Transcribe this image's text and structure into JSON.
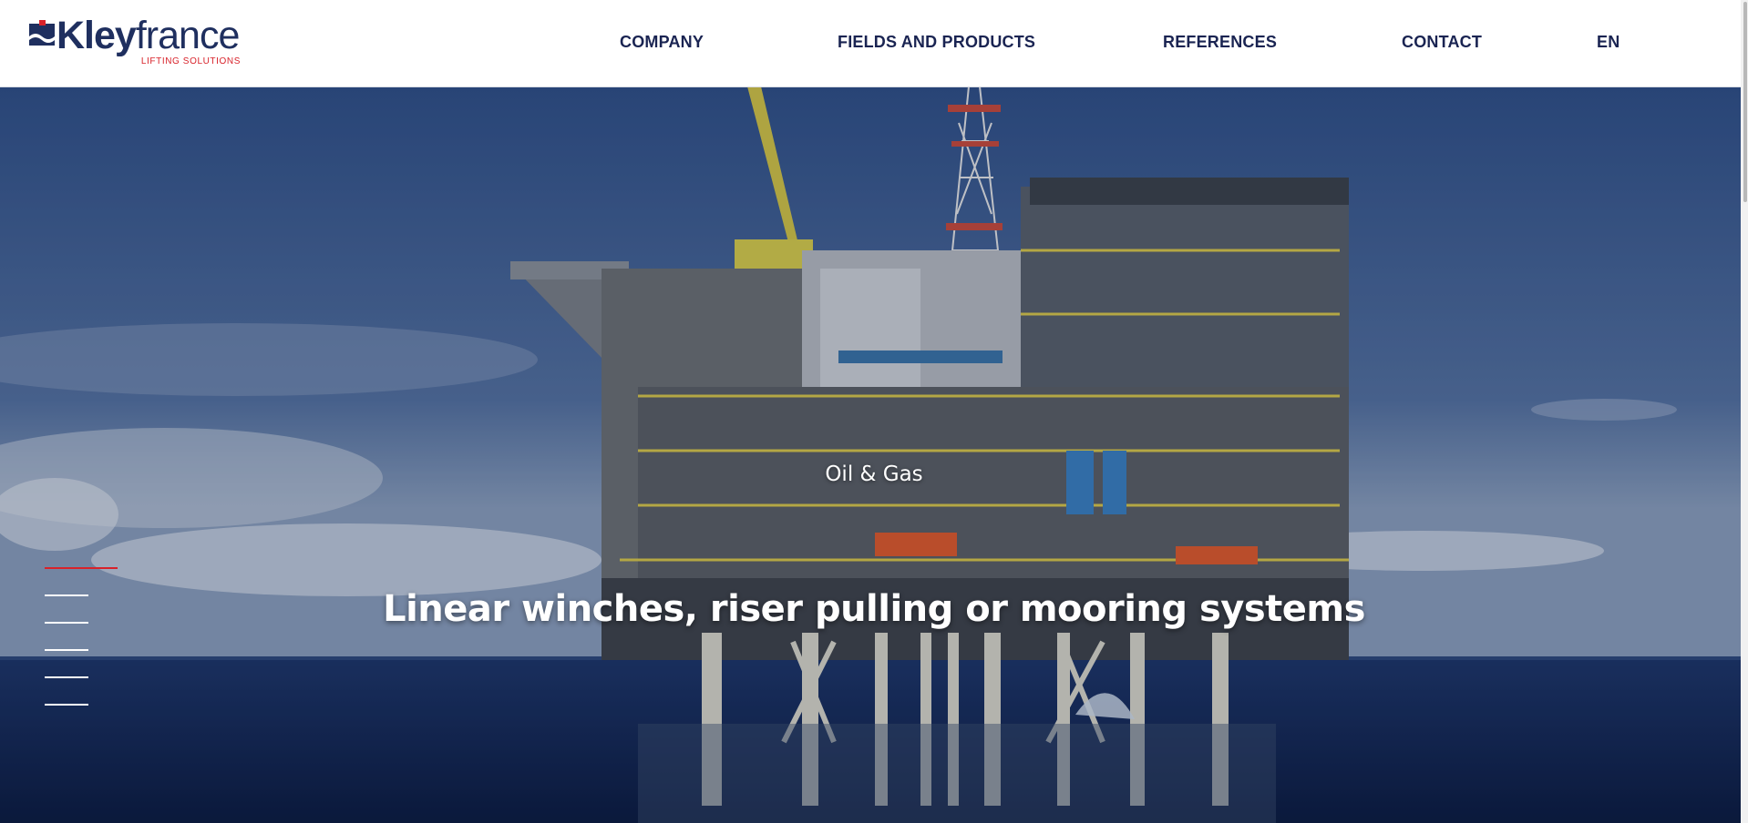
{
  "brand": {
    "name_bold": "Kley",
    "name_light": "france",
    "tagline": "LIFTING SOLUTIONS",
    "colors": {
      "navy": "#1f2f5f",
      "red": "#d8222a"
    }
  },
  "nav": {
    "items": [
      {
        "label": "COMPANY"
      },
      {
        "label": "FIELDS AND PRODUCTS"
      },
      {
        "label": "REFERENCES"
      },
      {
        "label": "CONTACT"
      }
    ],
    "language": "EN"
  },
  "hero": {
    "category": "Oil & Gas",
    "title": "Linear winches, riser pulling or mooring systems",
    "slides_total": 6,
    "active_slide": 1
  }
}
